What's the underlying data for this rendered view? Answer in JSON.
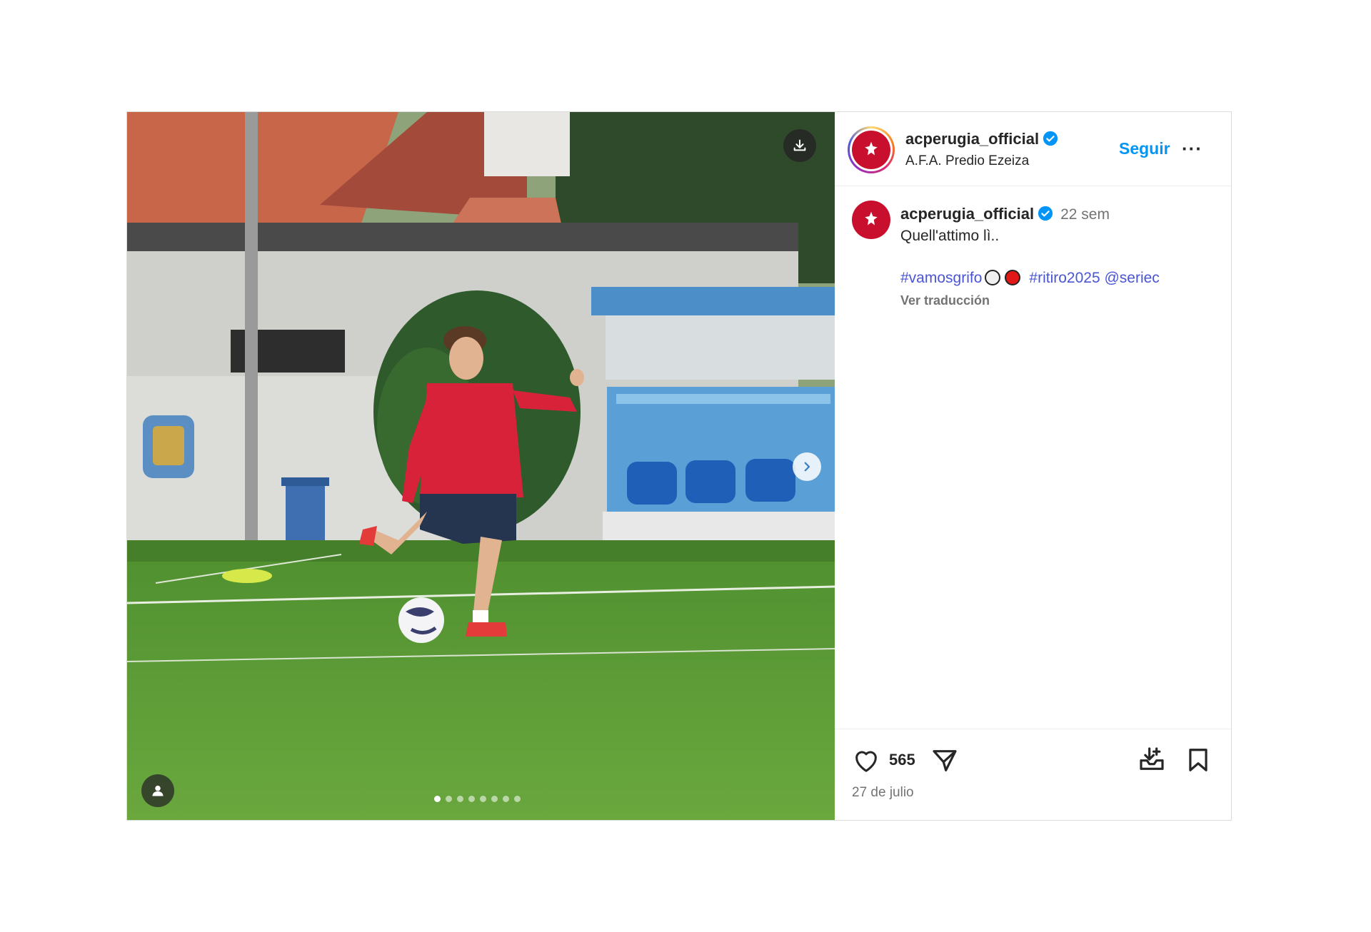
{
  "post": {
    "author": {
      "username": "acperugia_official",
      "verified": true,
      "location": "A.F.A. Predio Ezeiza"
    },
    "follow_label": "Seguir",
    "more_label": "···",
    "caption": {
      "username": "acperugia_official",
      "time_ago": "22 sem",
      "text": "Quell'attimo lì..",
      "tag_vamosgrifo": "#vamosgrifo",
      "tag_ritiro": "#ritiro2025",
      "mention": "@seriec",
      "translate_label": "Ver traducción"
    },
    "likes": "565",
    "date": "27 de julio",
    "carousel": {
      "slides": 8,
      "active_index": 0
    }
  },
  "colors": {
    "link": "#0095f6",
    "hashtag": "#4a55d6",
    "muted": "#737373",
    "club_red": "#c8102e"
  },
  "icons": [
    "download-icon",
    "chevron-right-icon",
    "user-tag-icon",
    "verified-badge-icon",
    "heart-icon",
    "share-icon",
    "save-to-collection-icon",
    "bookmark-icon"
  ]
}
